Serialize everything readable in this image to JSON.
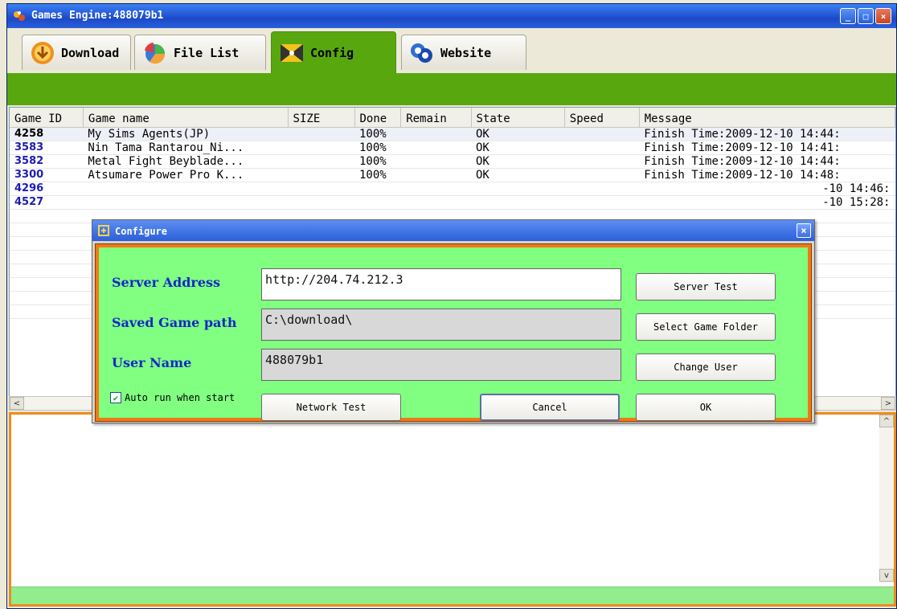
{
  "window": {
    "title": "Games Engine:488079b1",
    "min": "_",
    "max": "□",
    "close": "×"
  },
  "tabs": [
    {
      "label": "Download",
      "icon": "download-icon"
    },
    {
      "label": "File List",
      "icon": "pie-chart-icon"
    },
    {
      "label": "Config",
      "icon": "config-icon",
      "active": true
    },
    {
      "label": "Website",
      "icon": "globe-icon"
    }
  ],
  "table": {
    "columns": [
      "Game ID",
      "Game name",
      "SIZE",
      "Done",
      "Remain",
      "State",
      "Speed",
      "Message"
    ],
    "rows": [
      {
        "id": "4258",
        "name": "My Sims Agents(JP)",
        "size": "",
        "done": "100%",
        "remain": "",
        "state": "OK",
        "speed": "",
        "message": "Finish Time:2009-12-10 14:44:"
      },
      {
        "id": "3583",
        "name": "Nin Tama Rantarou_Ni...",
        "size": "",
        "done": "100%",
        "remain": "",
        "state": "OK",
        "speed": "",
        "message": "Finish Time:2009-12-10 14:41:"
      },
      {
        "id": "3582",
        "name": "Metal Fight Beyblade...",
        "size": "",
        "done": "100%",
        "remain": "",
        "state": "OK",
        "speed": "",
        "message": "Finish Time:2009-12-10 14:44:"
      },
      {
        "id": "3300",
        "name": "Atsumare Power Pro K...",
        "size": "",
        "done": "100%",
        "remain": "",
        "state": "OK",
        "speed": "",
        "message": "Finish Time:2009-12-10 14:48:"
      },
      {
        "id": "4296",
        "name": "",
        "size": "",
        "done": "",
        "remain": "",
        "state": "",
        "speed": "",
        "message": "-10 14:46:"
      },
      {
        "id": "4527",
        "name": "",
        "size": "",
        "done": "",
        "remain": "",
        "state": "",
        "speed": "",
        "message": "-10 15:28:"
      }
    ]
  },
  "scroll": {
    "left": "<",
    "right": ">",
    "up": "^",
    "down": "v"
  },
  "dialog": {
    "title": "Configure",
    "close": "×",
    "server_label": "Server Address",
    "server_value": "http://204.74.212.3",
    "path_label": "Saved Game path",
    "path_value": "C:\\download\\",
    "user_label": "User Name",
    "user_value": "488079b1",
    "server_test": "Server Test",
    "select_folder": "Select Game Folder",
    "change_user": "Change User",
    "auto_run": "Auto run when start",
    "auto_run_checked": true,
    "network_test": "Network Test",
    "cancel": "Cancel",
    "ok": "OK"
  },
  "colors": {
    "accent_green": "#59a70f",
    "dialog_green": "#80ff80",
    "orange": "#f08a1c",
    "id_blue": "#1d1db0"
  }
}
